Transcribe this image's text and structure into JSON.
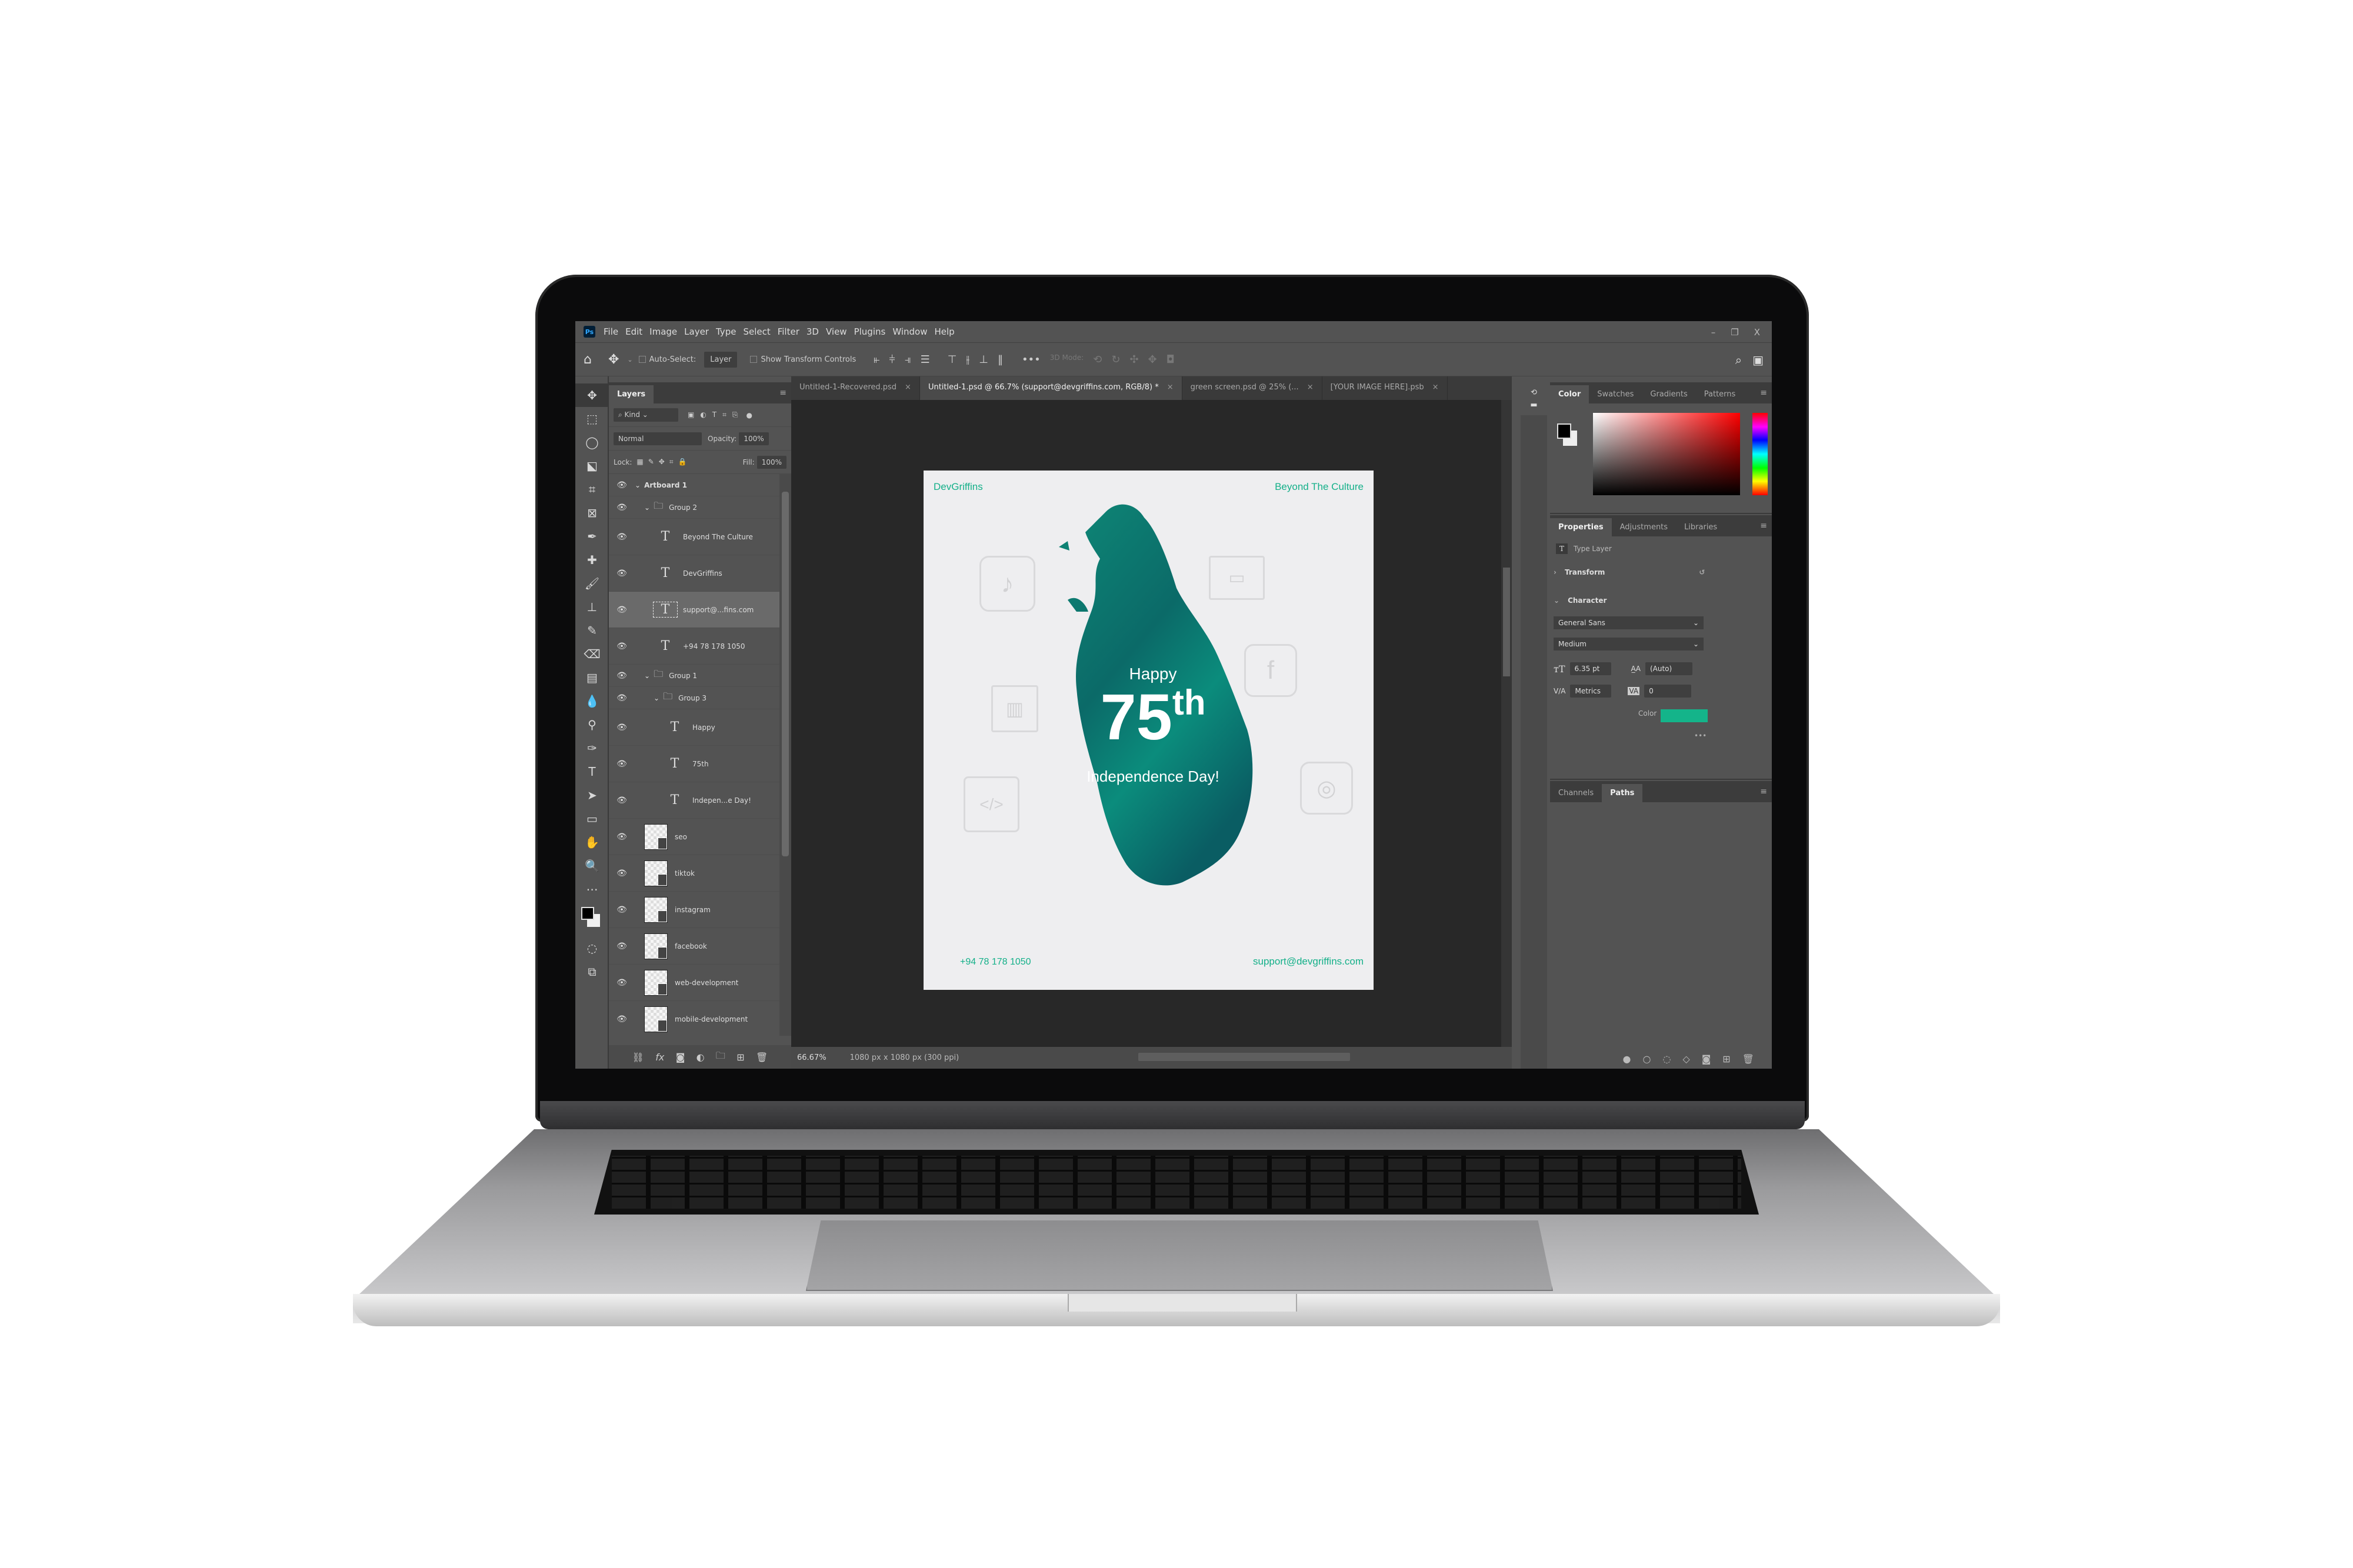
{
  "app": {
    "logo": "Ps",
    "menu": [
      "File",
      "Edit",
      "Image",
      "Layer",
      "Type",
      "Select",
      "Filter",
      "3D",
      "View",
      "Plugins",
      "Window",
      "Help"
    ],
    "window_controls": {
      "minimize": "–",
      "restore": "❐",
      "close": "X"
    }
  },
  "options_bar": {
    "home_icon": "⌂",
    "move_icon": "✥",
    "auto_select_label": "Auto-Select:",
    "auto_select_value": "Layer",
    "show_transform_label": "Show Transform Controls",
    "more_label": "•••",
    "mode_3d_label": "3D Mode:",
    "search_icon": "⌕",
    "workspace_icon": "▣"
  },
  "tools": [
    "move",
    "marquee",
    "lasso",
    "object-select",
    "crop",
    "frame",
    "eyedropper",
    "healing",
    "brush",
    "stamp",
    "history-brush",
    "eraser",
    "gradient",
    "blur",
    "dodge",
    "pen",
    "type",
    "path-select",
    "rectangle",
    "hand",
    "zoom",
    "edit-toolbar"
  ],
  "tool_glyphs": [
    "✥",
    "⬚",
    "◯",
    "⬕",
    "⌗",
    "⊠",
    "✒",
    "✚",
    "🖌",
    "⊥",
    "✎",
    "⌫",
    "▤",
    "💧",
    "⚲",
    "✑",
    "T",
    "➤",
    "▭",
    "✋",
    "🔍",
    "⋯"
  ],
  "layers_panel": {
    "tab": "Layers",
    "filter_kind": "Kind",
    "blend_mode": "Normal",
    "opacity_label": "Opacity:",
    "opacity_value": "100%",
    "lock_label": "Lock:",
    "fill_label": "Fill:",
    "fill_value": "100%",
    "layers": [
      {
        "name": "Artboard 1",
        "kind": "artboard",
        "indent": 0
      },
      {
        "name": "Group 2",
        "kind": "group",
        "indent": 1
      },
      {
        "name": "Beyond The Culture",
        "kind": "text",
        "indent": 2
      },
      {
        "name": "DevGriffins",
        "kind": "text",
        "indent": 2
      },
      {
        "name": "support@...fins.com",
        "kind": "text",
        "indent": 2,
        "selected": true
      },
      {
        "name": "+94 78 178 1050",
        "kind": "text",
        "indent": 2
      },
      {
        "name": "Group 1",
        "kind": "group",
        "indent": 1
      },
      {
        "name": "Group 3",
        "kind": "group",
        "indent": 2
      },
      {
        "name": "Happy",
        "kind": "text",
        "indent": 3
      },
      {
        "name": "75th",
        "kind": "text",
        "indent": 3
      },
      {
        "name": "Indepen...e Day!",
        "kind": "text",
        "indent": 3
      },
      {
        "name": "seo",
        "kind": "smart",
        "indent": 1
      },
      {
        "name": "tiktok",
        "kind": "smart",
        "indent": 1
      },
      {
        "name": "instagram",
        "kind": "smart",
        "indent": 1
      },
      {
        "name": "facebook",
        "kind": "smart",
        "indent": 1
      },
      {
        "name": "web-development",
        "kind": "smart",
        "indent": 1
      },
      {
        "name": "mobile-development",
        "kind": "smart",
        "indent": 1
      }
    ],
    "footer_icons": [
      "link",
      "fx",
      "mask",
      "adjustment",
      "group",
      "new-layer",
      "trash"
    ]
  },
  "document_tabs": [
    {
      "label": "Untitled-1-Recovered.psd",
      "active": false
    },
    {
      "label": "Untitled-1.psd @ 66.7% (support@devgriffins.com, RGB/8) *",
      "active": true
    },
    {
      "label": "green screen.psd @ 25% (...",
      "active": false
    },
    {
      "label": "[YOUR IMAGE HERE].psb",
      "active": false
    }
  ],
  "status_bar": {
    "zoom": "66.67%",
    "doc_info": "1080 px x 1080 px (300 ppi)"
  },
  "artwork": {
    "brand": "DevGriffins",
    "tagline": "Beyond The Culture",
    "line1": "Happy",
    "line2": "75",
    "line2_sup": "th",
    "line3": "Independence Day!",
    "phone": "+94 78 178 1050",
    "email": "support@devgriffins.com",
    "accent_color": "#14b089",
    "island_color_top": "#0b6f6a",
    "island_color_bottom": "#0a8a7a",
    "ghost_icons": [
      "tiktok",
      "web-development",
      "facebook",
      "seo",
      "mobile-development",
      "instagram"
    ]
  },
  "color_panel": {
    "tabs": [
      "Color",
      "Swatches",
      "Gradients",
      "Patterns"
    ],
    "active": "Color",
    "foreground": "#000000",
    "background": "#eeeeee"
  },
  "properties_panel": {
    "tabs": [
      "Properties",
      "Adjustments",
      "Libraries"
    ],
    "active": "Properties",
    "layer_type": "Type Layer",
    "transform_label": "Transform",
    "character_label": "Character",
    "font_family": "General Sans",
    "font_style": "Medium",
    "font_size": "6.35 pt",
    "leading": "(Auto)",
    "kerning": "Metrics",
    "tracking": "0",
    "color_label": "Color",
    "text_color": "#14b48a",
    "more": "•••"
  },
  "paths_panel": {
    "tabs": [
      "Channels",
      "Paths"
    ],
    "active": "Paths"
  }
}
